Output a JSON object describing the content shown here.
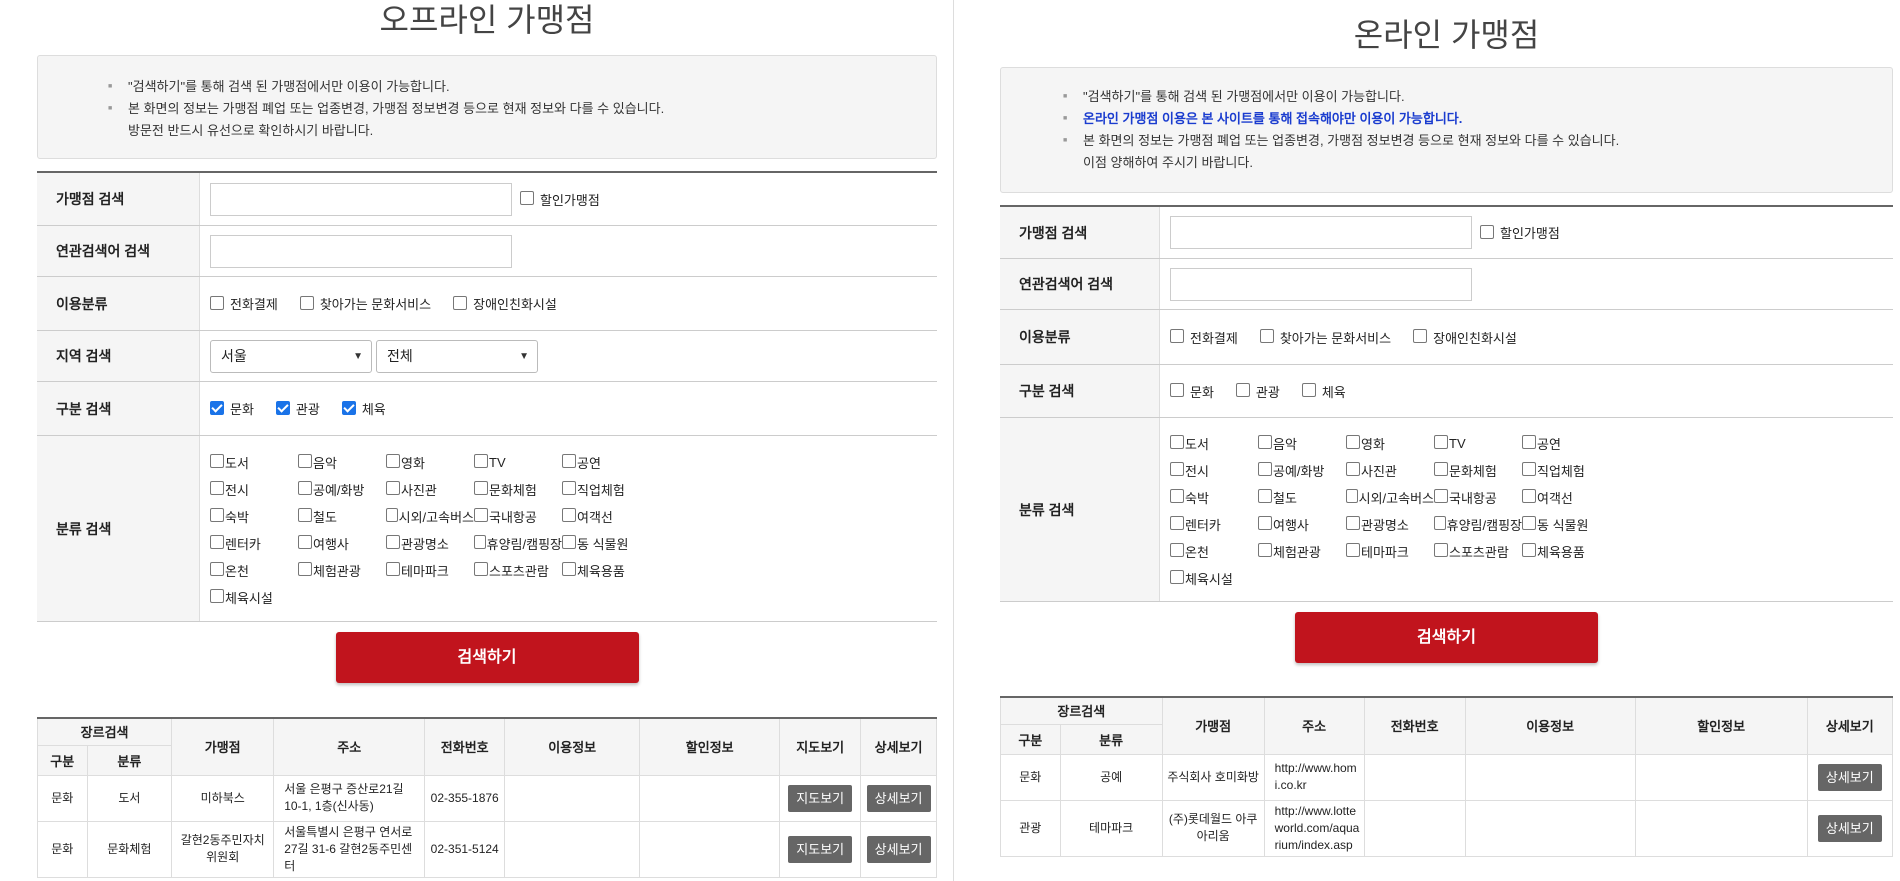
{
  "offline": {
    "title": "오프라인 가맹점",
    "notice": [
      "\"검색하기\"를 통해 검색 된 가맹점에서만 이용이 가능합니다.",
      "본 화면의 정보는 가맹점 폐업 또는 업종변경, 가맹점 정보변경 등으로 현재 정보와 다를 수 있습니다.",
      "방문전 반드시 유선으로 확인하시기 바랍니다."
    ],
    "labels": {
      "store_search": "가맹점 검색",
      "related_search": "연관검색어 검색",
      "usage": "이용분류",
      "region": "지역 검색",
      "division": "구분 검색",
      "category": "분류 검색"
    },
    "discount_label": "할인가맹점",
    "usage_options": [
      "전화결제",
      "찾아가는 문화서비스",
      "장애인친화시설"
    ],
    "region_selected": "서울",
    "district_selected": "전체",
    "division_options": [
      "문화",
      "관광",
      "체육"
    ],
    "categories": [
      "도서",
      "음악",
      "영화",
      "TV",
      "공연",
      "전시",
      "공예/화방",
      "사진관",
      "문화체험",
      "직업체험",
      "숙박",
      "철도",
      "시외/고속버스",
      "국내항공",
      "여객선",
      "렌터카",
      "여행사",
      "관광명소",
      "휴양림/캠핑장",
      "동 식물원",
      "온천",
      "체험관광",
      "테마파크",
      "스포츠관람",
      "체육용품",
      "체육시설"
    ],
    "search_button": "검색하기",
    "table": {
      "genre": "장르검색",
      "div": "구분",
      "cls": "분류",
      "store": "가맹점",
      "addr": "주소",
      "phone": "전화번호",
      "usage": "이용정보",
      "discount": "할인정보",
      "map": "지도보기",
      "detail": "상세보기"
    },
    "rows": [
      {
        "div": "문화",
        "cls": "도서",
        "store": "미하북스",
        "addr": "서울 은평구 증산로21길 10-1, 1층(신사동)",
        "phone": "02-355-1876",
        "map": "지도보기",
        "detail": "상세보기"
      },
      {
        "div": "문화",
        "cls": "문화체험",
        "store": "갈현2동주민자치위원회",
        "addr": "서울특별시 은평구 연서로27길 31-6 갈현2동주민센터",
        "phone": "02-351-5124",
        "map": "지도보기",
        "detail": "상세보기"
      }
    ]
  },
  "online": {
    "title": "온라인 가맹점",
    "notice": [
      "\"검색하기\"를 통해 검색 된 가맹점에서만 이용이 가능합니다.",
      "온라인 가맹점 이용은 본 사이트를 통해 접속해야만 이용이 가능합니다.",
      "본 화면의 정보는 가맹점 폐업 또는 업종변경, 가맹점 정보변경 등으로 현재 정보와 다를 수 있습니다.",
      "이점 양해하여 주시기 바랍니다."
    ],
    "labels": {
      "store_search": "가맹점 검색",
      "related_search": "연관검색어 검색",
      "usage": "이용분류",
      "division": "구분 검색",
      "category": "분류 검색"
    },
    "discount_label": "할인가맹점",
    "usage_options": [
      "전화결제",
      "찾아가는 문화서비스",
      "장애인친화시설"
    ],
    "division_options": [
      "문화",
      "관광",
      "체육"
    ],
    "categories": [
      "도서",
      "음악",
      "영화",
      "TV",
      "공연",
      "전시",
      "공예/화방",
      "사진관",
      "문화체험",
      "직업체험",
      "숙박",
      "철도",
      "시외/고속버스",
      "국내항공",
      "여객선",
      "렌터카",
      "여행사",
      "관광명소",
      "휴양림/캠핑장",
      "동 식물원",
      "온천",
      "체험관광",
      "테마파크",
      "스포츠관람",
      "체육용품",
      "체육시설"
    ],
    "search_button": "검색하기",
    "table": {
      "genre": "장르검색",
      "div": "구분",
      "cls": "분류",
      "store": "가맹점",
      "addr": "주소",
      "phone": "전화번호",
      "usage": "이용정보",
      "discount": "할인정보",
      "detail": "상세보기"
    },
    "rows": [
      {
        "div": "문화",
        "cls": "공예",
        "store": "주식회사 호미화방",
        "addr": "http://www.homi.co.kr",
        "detail": "상세보기"
      },
      {
        "div": "관광",
        "cls": "테마파크",
        "store": "(주)롯데월드 아쿠아리움",
        "addr": "http://www.lotteworld.com/aquarium/index.asp",
        "detail": "상세보기"
      }
    ]
  },
  "colors": {
    "search_button": "#c1141d",
    "notice_highlight": "#1a3ccf",
    "checked": "#1a73e8",
    "table_button": "#666666"
  }
}
